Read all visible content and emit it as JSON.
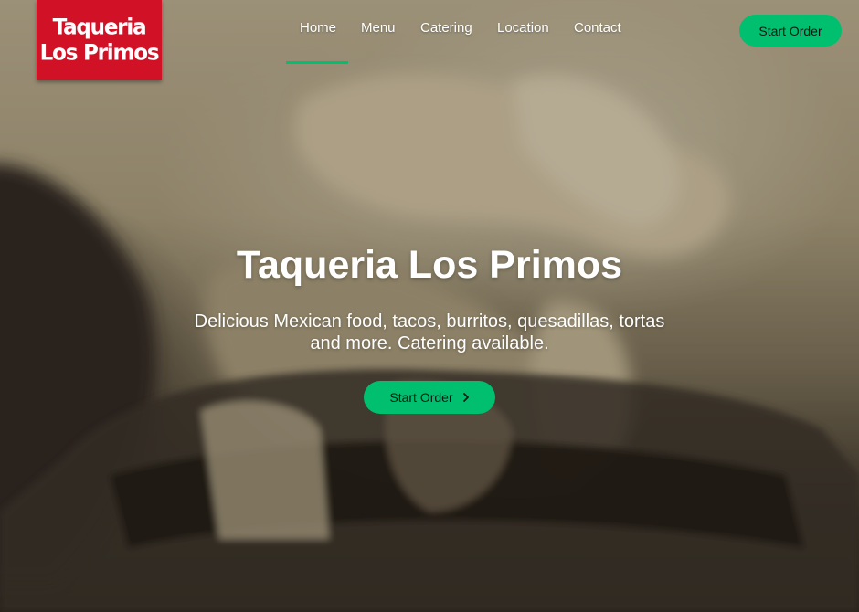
{
  "brand": {
    "logo_line1": "Taqueria",
    "logo_line2": "Los Primos",
    "accent_color": "#00bf6f",
    "logo_color": "#d11126"
  },
  "nav": {
    "items": [
      {
        "label": "Home",
        "active": true
      },
      {
        "label": "Menu",
        "active": false
      },
      {
        "label": "Catering",
        "active": false
      },
      {
        "label": "Location",
        "active": false
      },
      {
        "label": "Contact",
        "active": false
      }
    ]
  },
  "header": {
    "cta_label": "Start Order"
  },
  "hero": {
    "title": "Taqueria Los Primos",
    "subtitle": "Delicious Mexican food, tacos, burritos, quesadillas, tortas and more. Catering available.",
    "cta_label": "Start Order",
    "cta_icon": "chevron-right-icon"
  }
}
